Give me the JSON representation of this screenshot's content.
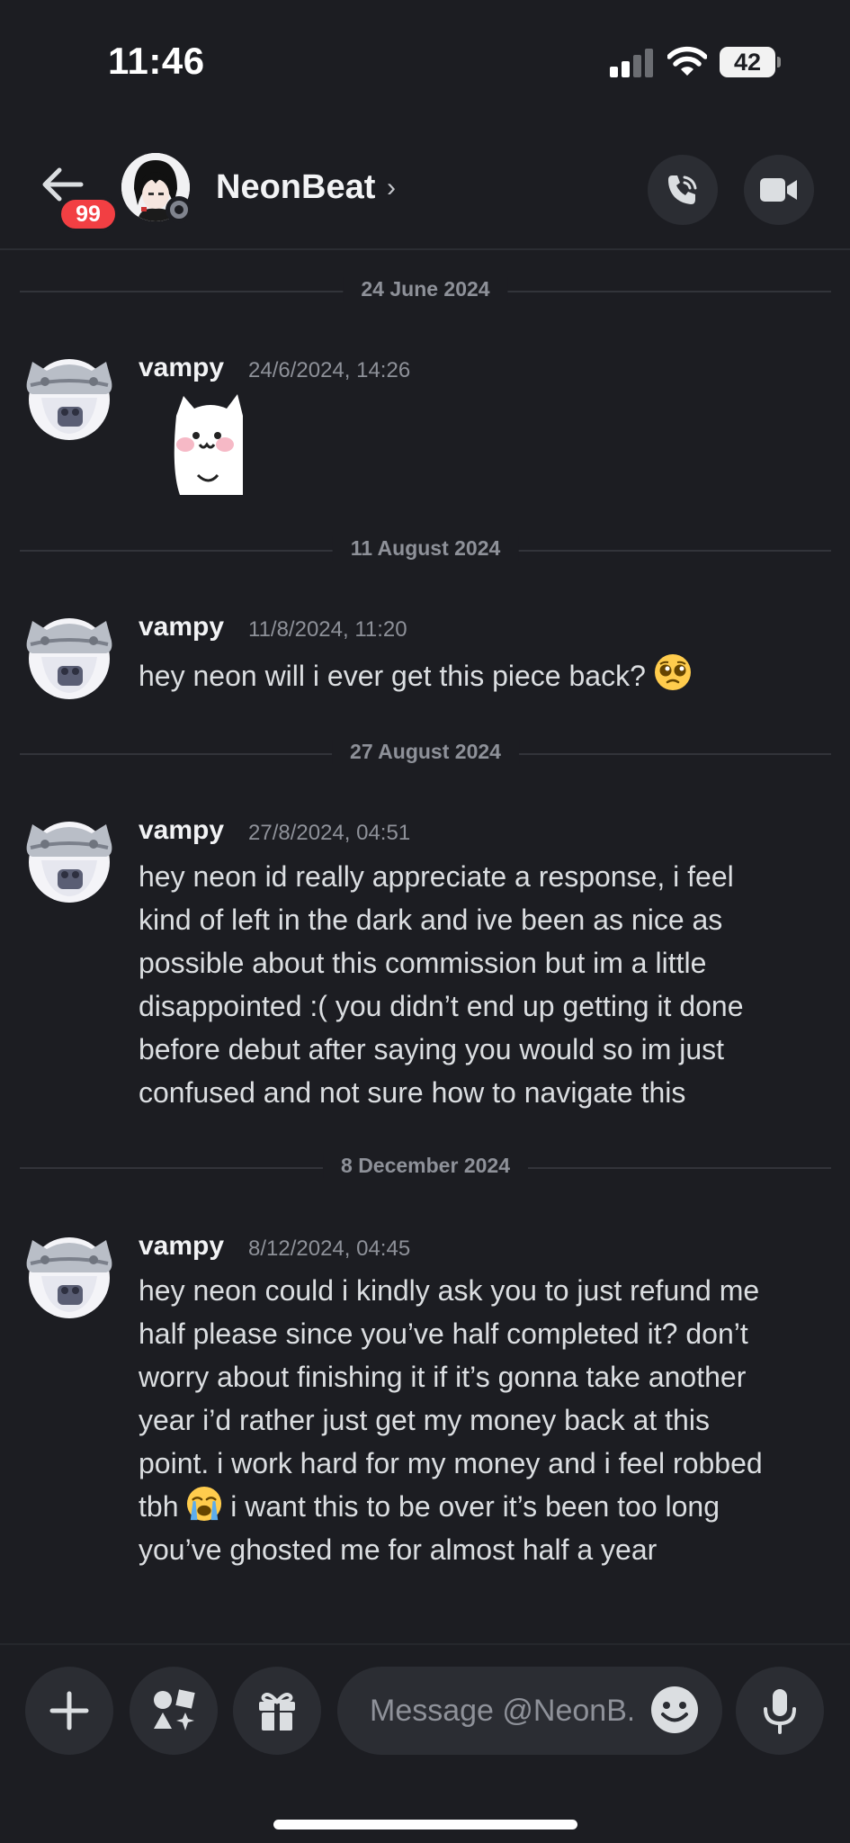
{
  "status_bar": {
    "time": "11:46",
    "battery": "42"
  },
  "header": {
    "back_icon": "arrow-left-icon",
    "unread_badge": "99",
    "channel_name": "NeonBeat",
    "chevron": "›",
    "call_icon": "phone-icon",
    "video_icon": "video-camera-icon"
  },
  "messages": [
    {
      "date_divider": "24 June 2024",
      "author": "vampy",
      "timestamp": "24/6/2024, 14:26",
      "text": "",
      "sticker": "cat-sticker"
    },
    {
      "date_divider": "11 August 2024",
      "author": "vampy",
      "timestamp": "11/8/2024, 11:20",
      "text": "hey neon will i ever get this piece back?",
      "emoji": "pleading-face-emoji"
    },
    {
      "date_divider": "27 August 2024",
      "author": "vampy",
      "timestamp": "27/8/2024, 04:51",
      "lines": [
        "hey neon id really appreciate a response, i feel",
        "kind of left in the dark and ive been as nice as",
        "possible about this commission but im a little",
        "disappointed :( you didn’t end up getting it done",
        "before debut after saying you would so im just",
        "confused and not sure how to navigate this"
      ]
    },
    {
      "date_divider": "8 December 2024",
      "author": "vampy",
      "timestamp": "8/12/2024, 04:45",
      "lines": [
        "hey neon could i kindly ask you to just refund me",
        "half please since you’ve half completed it? don’t",
        "worry about finishing it if it’s gonna take another",
        "year i’d rather just get my money back at this",
        "point. i work hard for my money and i feel robbed",
        "tbh",
        "i want this to be over it’s been too long",
        "you’ve ghosted me for almost half a year"
      ],
      "emoji": "loudly-crying-face-emoji"
    }
  ],
  "composer": {
    "placeholder": "Message @NeonB...",
    "plus_icon": "plus-icon",
    "apps_icon": "apps-icon",
    "gift_icon": "gift-icon",
    "emoji_icon": "smiley-icon",
    "mic_icon": "microphone-icon"
  }
}
